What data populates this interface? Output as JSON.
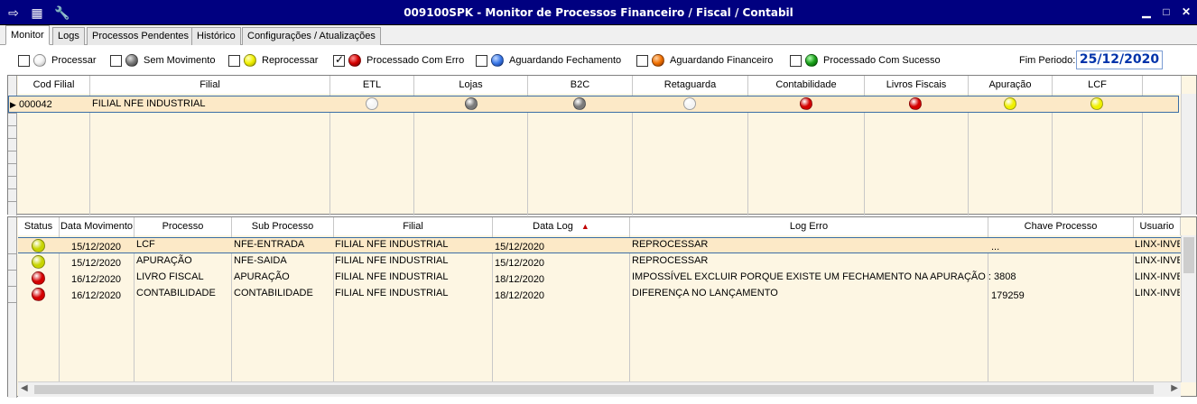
{
  "window": {
    "title": "009100SPK - Monitor de Processos Financeiro / Fiscal / Contabil"
  },
  "tabs": [
    {
      "label": "Monitor",
      "active": true
    },
    {
      "label": "Logs"
    },
    {
      "label": "Processos Pendentes"
    },
    {
      "label": "Histórico"
    },
    {
      "label": "Configurações / Atualizações"
    }
  ],
  "legend": [
    {
      "label": "Processar",
      "checked": false,
      "color": "#f4f4f4"
    },
    {
      "label": "Sem Movimento",
      "checked": false,
      "color": "#7a7a7a"
    },
    {
      "label": "Reprocessar",
      "checked": false,
      "color": "#f0f000"
    },
    {
      "label": "Processado Com Erro",
      "checked": true,
      "color": "#d40000"
    },
    {
      "label": "Aguardando Fechamento",
      "checked": false,
      "color": "#3a78e8"
    },
    {
      "label": "Aguardando Financeiro",
      "checked": false,
      "color": "#f07000"
    },
    {
      "label": "Processado Com Sucesso",
      "checked": false,
      "color": "#1aa01a"
    }
  ],
  "fim_periodo": {
    "label": "Fim Periodo:",
    "value": "25/12/2020"
  },
  "top_grid": {
    "columns": [
      "Cod Filial",
      "Filial",
      "ETL",
      "Lojas",
      "B2C",
      "Retaguarda",
      "Contabilidade",
      "Livros Fiscais",
      "Apuração",
      "LCF"
    ],
    "rows": [
      {
        "cod": "000042",
        "filial": "FILIAL NFE INDUSTRIAL",
        "status_colors": [
          "#f4f4f4",
          "#7a7a7a",
          "#7a7a7a",
          "#f4f4f4",
          "#d40000",
          "#d40000",
          "#f0f000",
          "#f0f000"
        ]
      }
    ]
  },
  "log_grid": {
    "columns": [
      "Status",
      "Data Movimento",
      "Processo",
      "Sub Processo",
      "Filial",
      "Data Log",
      "Log Erro",
      "Chave Processo",
      "Usuario"
    ],
    "sort_indicator": "▲",
    "rows": [
      {
        "status_color": "#c8d400",
        "data_mov": "15/12/2020",
        "processo": "LCF",
        "sub": "NFE-ENTRADA",
        "filial": "FILIAL NFE INDUSTRIAL",
        "data_log": "15/12/2020",
        "log_erro": "REPROCESSAR",
        "chave": "...",
        "usuario": "LINX-INVES"
      },
      {
        "status_color": "#c8d400",
        "data_mov": "15/12/2020",
        "processo": "APURAÇÃO",
        "sub": "NFE-SAIDA",
        "filial": "FILIAL NFE INDUSTRIAL",
        "data_log": "15/12/2020",
        "log_erro": "REPROCESSAR",
        "chave": "",
        "usuario": "LINX-INVES"
      },
      {
        "status_color": "#d40000",
        "data_mov": "16/12/2020",
        "processo": "LIVRO FISCAL",
        "sub": "APURAÇÃO",
        "filial": "FILIAL NFE INDUSTRIAL",
        "data_log": "18/12/2020",
        "log_erro": "IMPOSSÍVEL EXCLUIR PORQUE EXISTE UM FECHAMENTO NA APURAÇÃO : 3808",
        "chave": "",
        "usuario": "LINX-INVES"
      },
      {
        "status_color": "#d40000",
        "data_mov": "16/12/2020",
        "processo": "CONTABILIDADE",
        "sub": "CONTABILIDADE",
        "filial": "FILIAL NFE INDUSTRIAL",
        "data_log": "18/12/2020",
        "log_erro": "DIFERENÇA NO LANÇAMENTO",
        "chave": "179259",
        "usuario": "LINX-INVES"
      }
    ]
  }
}
